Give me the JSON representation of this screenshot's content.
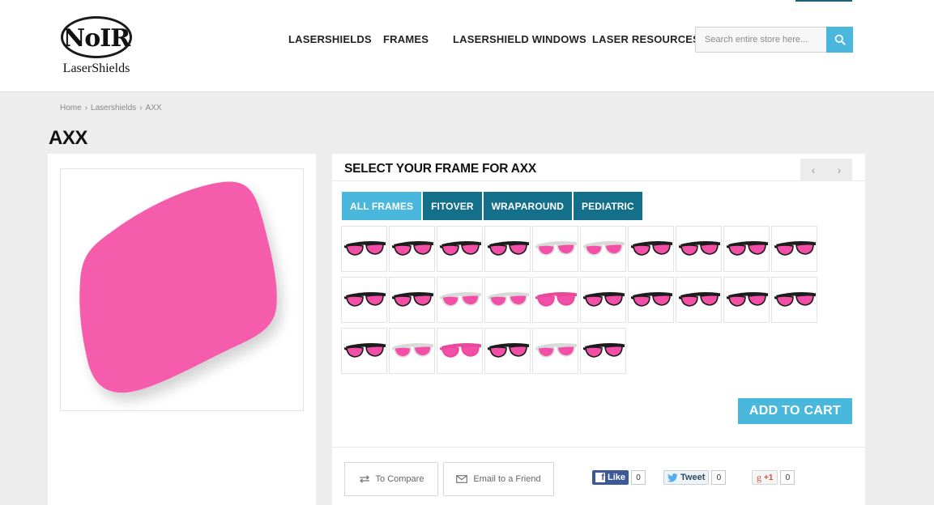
{
  "header": {
    "logo": {
      "name": "NoIR",
      "subtitle": "LaserShields"
    },
    "nav": [
      {
        "label": "LASERSHIELDS"
      },
      {
        "label": "FRAMES"
      },
      {
        "label": "LASERSHIELD WINDOWS"
      },
      {
        "label": "LASER RESOURCES"
      }
    ],
    "search": {
      "placeholder": "Search entire store here...",
      "icon": "search-icon"
    }
  },
  "breadcrumb": {
    "home": "Home",
    "category": "Lasershields",
    "current": "AXX"
  },
  "product": {
    "title": "AXX",
    "lens_color": "#f55bab"
  },
  "frame_selector": {
    "title": "SELECT YOUR FRAME FOR AXX",
    "pager": {
      "prev": "‹",
      "next": "›"
    },
    "filters": [
      {
        "label": "ALL FRAMES",
        "active": true
      },
      {
        "label": "FITOVER",
        "active": false
      },
      {
        "label": "WRAPAROUND",
        "active": false
      },
      {
        "label": "PEDIATRIC",
        "active": false
      }
    ],
    "frame_count": 26,
    "frames": [
      {
        "frame": "black",
        "lens": "#f34fa6"
      },
      {
        "frame": "black",
        "lens": "#f34fa6"
      },
      {
        "frame": "black",
        "lens": "#f34fa6"
      },
      {
        "frame": "black",
        "lens": "#f34fa6"
      },
      {
        "frame": "white",
        "lens": "#f34fa6"
      },
      {
        "frame": "white",
        "lens": "#f34fa6"
      },
      {
        "frame": "black",
        "lens": "#f34fa6"
      },
      {
        "frame": "black",
        "lens": "#f34fa6"
      },
      {
        "frame": "black",
        "lens": "#f34fa6"
      },
      {
        "frame": "black",
        "lens": "#f34fa6"
      },
      {
        "frame": "black",
        "lens": "#f34fa6"
      },
      {
        "frame": "black",
        "lens": "#f34fa6"
      },
      {
        "frame": "white",
        "lens": "#f34fa6"
      },
      {
        "frame": "white",
        "lens": "#f34fa6"
      },
      {
        "frame": "pink",
        "lens": "#f34fa6"
      },
      {
        "frame": "black",
        "lens": "#f34fa6"
      },
      {
        "frame": "black",
        "lens": "#f34fa6"
      },
      {
        "frame": "black",
        "lens": "#f34fa6"
      },
      {
        "frame": "black",
        "lens": "#f34fa6"
      },
      {
        "frame": "black",
        "lens": "#f34fa6"
      },
      {
        "frame": "black",
        "lens": "#f34fa6"
      },
      {
        "frame": "white",
        "lens": "#f34fa6"
      },
      {
        "frame": "pink",
        "lens": "#f34fa6"
      },
      {
        "frame": "black",
        "lens": "#f34fa6"
      },
      {
        "frame": "white",
        "lens": "#f34fa6"
      },
      {
        "frame": "black",
        "lens": "#f34fa6"
      }
    ],
    "add_to_cart": "ADD TO CART"
  },
  "actions": {
    "compare": {
      "label": "To Compare",
      "icon": "compare-arrows-icon"
    },
    "email": {
      "label": "Email to a Friend",
      "icon": "envelope-icon"
    }
  },
  "social": {
    "facebook": {
      "label": "Like",
      "count": "0",
      "icon": "facebook-icon"
    },
    "twitter": {
      "label": "Tweet",
      "count": "0",
      "icon": "twitter-icon"
    },
    "google": {
      "label": "+1",
      "count": "0",
      "icon": "google-plus-icon"
    }
  },
  "colors": {
    "accent": "#4ab8dc",
    "filter_dark": "#136f8a",
    "lens_pink": "#f55bab",
    "facebook": "#3b5998"
  }
}
